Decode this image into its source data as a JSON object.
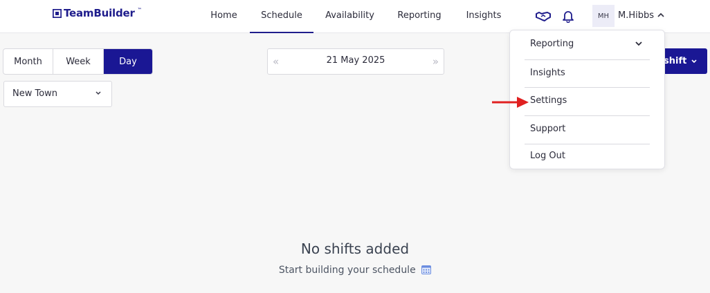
{
  "brand": {
    "name": "TeamBuilder",
    "tm": "™"
  },
  "nav": {
    "items": [
      {
        "label": "Home"
      },
      {
        "label": "Schedule"
      },
      {
        "label": "Availability"
      },
      {
        "label": "Reporting"
      },
      {
        "label": "Insights"
      }
    ],
    "active": "Schedule"
  },
  "icons": {
    "handshake": "handshake-icon",
    "bell": "bell-icon",
    "chevron_up": "chevron-up-icon"
  },
  "user": {
    "initials": "MH",
    "name": "M.Hibbs"
  },
  "views": {
    "month": "Month",
    "week": "Week",
    "day": "Day",
    "selected": "Day"
  },
  "location": {
    "selected": "New Town"
  },
  "date_nav": {
    "prev": "«",
    "date": "21 May 2025",
    "next": "»"
  },
  "add_shift": {
    "label": "shift"
  },
  "user_menu": {
    "items": [
      {
        "label": "Reporting"
      },
      {
        "label": "Insights"
      },
      {
        "label": "Settings"
      },
      {
        "label": "Support"
      },
      {
        "label": "Log Out"
      }
    ]
  },
  "empty_state": {
    "title": "No shifts added",
    "subtitle": "Start building your schedule"
  },
  "colors": {
    "brand": "#1a1794",
    "arrow": "#e02020",
    "background": "#f7f7f7"
  }
}
